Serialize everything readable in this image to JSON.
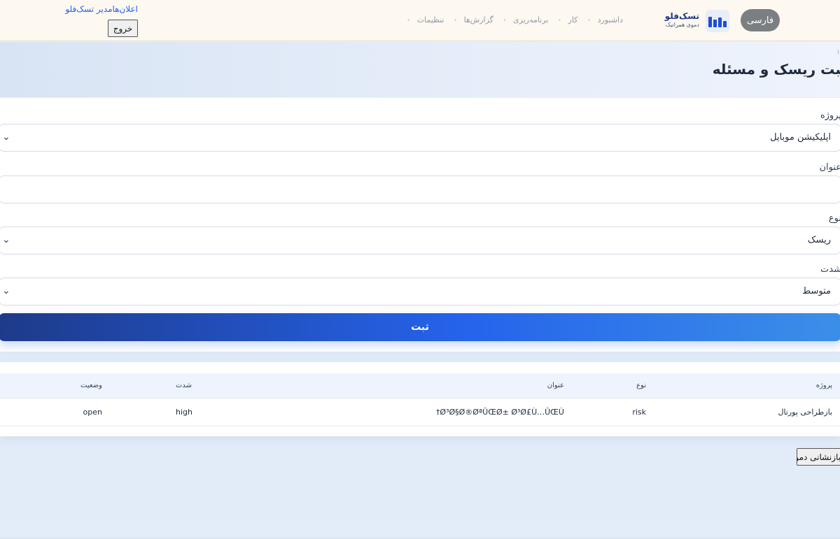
{
  "header": {
    "language_button": "فارسی",
    "brand_name": "تسک‌فلو",
    "brand_subtitle": "دموی همراتیک",
    "nav": [
      "داشبورد",
      "کار",
      "برنامه‌ریزی",
      "گزارش‌ها",
      "تنظیمات"
    ],
    "notifications_link": "اعلان‌هامدیر تسک‌فلو",
    "logout_button": "خروج"
  },
  "page": {
    "breadcrumb": "١",
    "title": "ثبت ریسک و مسئله"
  },
  "form": {
    "project": {
      "label": "پروژه",
      "value": "اپلیکیشن موبایل"
    },
    "title": {
      "label": "عنوان",
      "value": ""
    },
    "type": {
      "label": "نوع",
      "value": "ریسک"
    },
    "severity": {
      "label": "شدت",
      "value": "متوسط"
    },
    "submit_label": "ثبت"
  },
  "table": {
    "headers": {
      "project": "پروژه",
      "type": "نوع",
      "title": "عنوان",
      "severity": "شدت",
      "status": "وضعیت"
    },
    "rows": [
      {
        "project": "بازطراحی پورتال",
        "type": "risk",
        "title": "†Ø³Ø§Ø®ØªÛŒØ± Ø³Ø£Ù…ÛŒÙ",
        "severity": "high",
        "status": "open"
      }
    ]
  },
  "reset_button": "بازنشانی دمو",
  "colors": {
    "accent": "#2563eb",
    "brand_dark": "#1e3a8a",
    "header_bg": "#fdf8f0"
  }
}
